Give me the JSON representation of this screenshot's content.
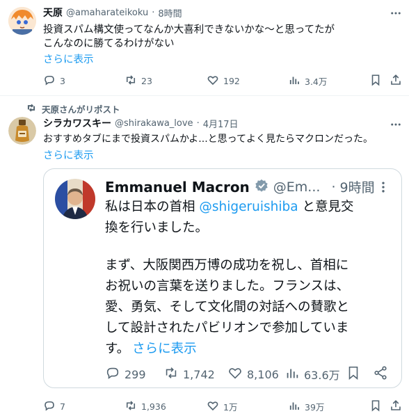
{
  "tweet1": {
    "display_name": "天原",
    "handle": "@amaharateikoku",
    "dot": "·",
    "time": "8時間",
    "text_line1": "投資スパム構文使ってなんか大喜利できないかな～と思ってたが",
    "text_line2": "こんなのに勝てるわけがない",
    "show_more": "さらに表示",
    "actions": {
      "replies": "3",
      "reposts": "23",
      "likes": "192",
      "views": "3.4万"
    }
  },
  "tweet2": {
    "repost_label": "天原さんがリポスト",
    "display_name": "シラカワスキー",
    "handle": "@shirakawa_love",
    "dot": "·",
    "time": "4月17日",
    "text": "おすすめタブにまで投資スパムかよ...と思ってよく見たらマクロンだった。",
    "quote": {
      "display_name": "Emmanuel Macron",
      "handle": "@Em...",
      "dot": "·",
      "time": "9時間",
      "line1_pre": "私は日本の首相 ",
      "mention": "@shigeruishiba",
      "line1_post": " と意見交",
      "line2": "換を行いました。",
      "line3": "まず、大阪関西万博の成功を祝し、首相に",
      "line4": "お祝いの言葉を送りました。フランスは、",
      "line5": "愛、勇気、そして文化間の対話への賛歌と",
      "line6": "して設計されたパビリオンで参加していま",
      "line7": "す。",
      "show_more": "さらに表示",
      "actions": {
        "replies": "299",
        "reposts": "1,742",
        "likes": "8,106",
        "views": "63.6万"
      }
    },
    "actions": {
      "replies": "7",
      "reposts": "1,936",
      "likes": "1万",
      "views": "39万"
    }
  },
  "colors": {
    "link": "#1d9bf0",
    "muted": "#536471",
    "text": "#0f1419",
    "verified": "#829aab"
  },
  "icons": [
    "reply-icon",
    "repost-icon",
    "like-icon",
    "views-icon",
    "bookmark-icon",
    "share-icon",
    "more-icon",
    "verified-badge-icon"
  ]
}
